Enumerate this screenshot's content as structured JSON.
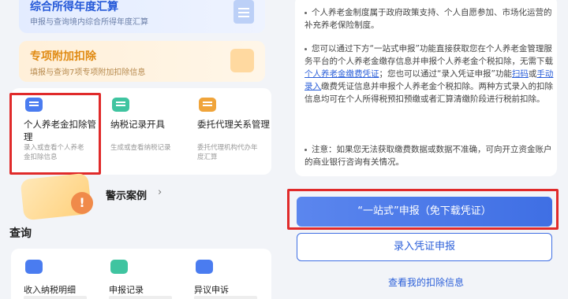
{
  "left": {
    "card_annual": {
      "title": "综合所得年度汇算",
      "subtitle": "申报与查询境内综合所得年度汇算"
    },
    "card_special": {
      "title": "专项附加扣除",
      "subtitle": "填报与查询7项专项附加扣除信息"
    },
    "grid1": [
      {
        "title": "个人养老金扣除管理",
        "subtitle": "录入或查看个人养老金扣除信息",
        "icon": "pension-icon",
        "color": "#4a7cf0"
      },
      {
        "title": "纳税记录开具",
        "subtitle": "生成或查看纳税记录",
        "icon": "tax-record-icon",
        "color": "#3fc4a0"
      },
      {
        "title": "委托代理关系管理",
        "subtitle": "委托代理机构代办年度汇算",
        "icon": "agency-icon",
        "color": "#f0a43a"
      }
    ],
    "warning": {
      "label": "警示案例",
      "badge": "!"
    },
    "query_section": {
      "title": "查询"
    },
    "grid2": [
      {
        "title": "收入纳税明细",
        "icon": "income-detail-icon",
        "color": "#4a7cf0"
      },
      {
        "title": "申报记录",
        "icon": "declare-record-icon",
        "color": "#3fc4a0"
      },
      {
        "title": "异议申诉",
        "icon": "appeal-icon",
        "color": "#4a7cf0"
      }
    ]
  },
  "right": {
    "para1": "个人养老金制度属于政府政策支持、个人自愿参加、市场化运营的补充养老保险制度。",
    "para2": {
      "a": "您可以通过下方“一站式申报”功能直接获取您在个人养老金管理服务平台的个人养老金缴存信息并申报个人养老金个税扣除，无需下载",
      "link1": "个人养老金缴费凭证",
      "b": "；您也可以通过“录入凭证申报”功能",
      "link2": "扫码",
      "c": "或",
      "link3": "手动录入",
      "d": "缴费凭证信息并申报个人养老金个税扣除。两种方式录入的扣除信息均可在个人所得税预扣预缴或者汇算清缴阶段进行税前扣除。"
    },
    "para3": "注意：如果您无法获取缴费数据或数据不准确，可向开立资金账户的商业银行咨询有关情况。",
    "btn_primary": "“一站式”申报（免下载凭证）",
    "btn_outline": "录入凭证申报",
    "link_bottom": "查看我的扣除信息"
  },
  "colors": {
    "accent": "#3f6fe4",
    "highlight": "#e02a2a"
  }
}
